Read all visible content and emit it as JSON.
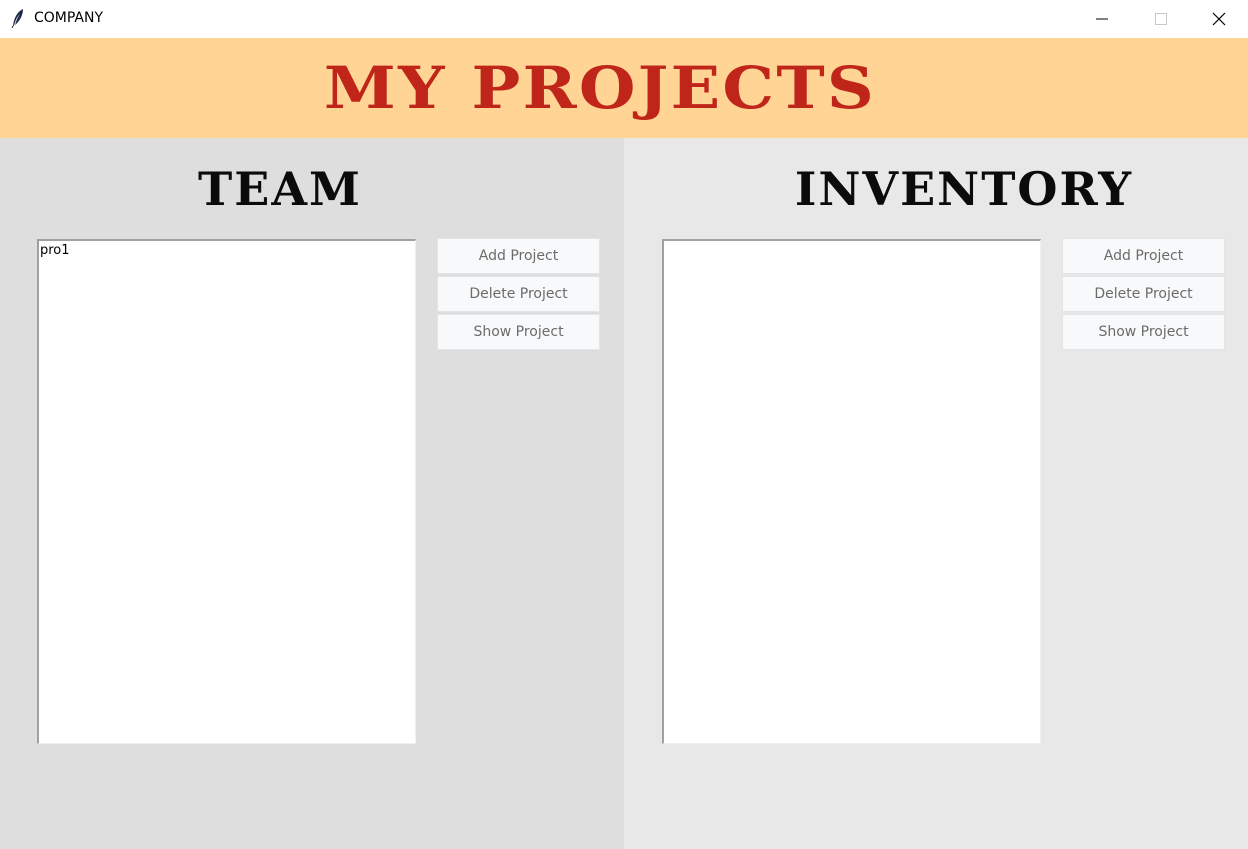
{
  "window": {
    "title": "COMPANY",
    "icons": {
      "app": "feather-icon",
      "minimize": "minimize-icon",
      "maximize": "maximize-icon",
      "close": "close-icon"
    }
  },
  "header": {
    "title": "MY PROJECTS",
    "background": "#ffd494",
    "color": "#c0251a"
  },
  "team": {
    "heading": "TEAM",
    "items": [
      "pro1"
    ],
    "buttons": {
      "add": "Add Project",
      "delete": "Delete Project",
      "show": "Show Project"
    }
  },
  "inventory": {
    "heading": "INVENTORY",
    "items": [],
    "buttons": {
      "add": "Add Project",
      "delete": "Delete Project",
      "show": "Show Project"
    }
  }
}
